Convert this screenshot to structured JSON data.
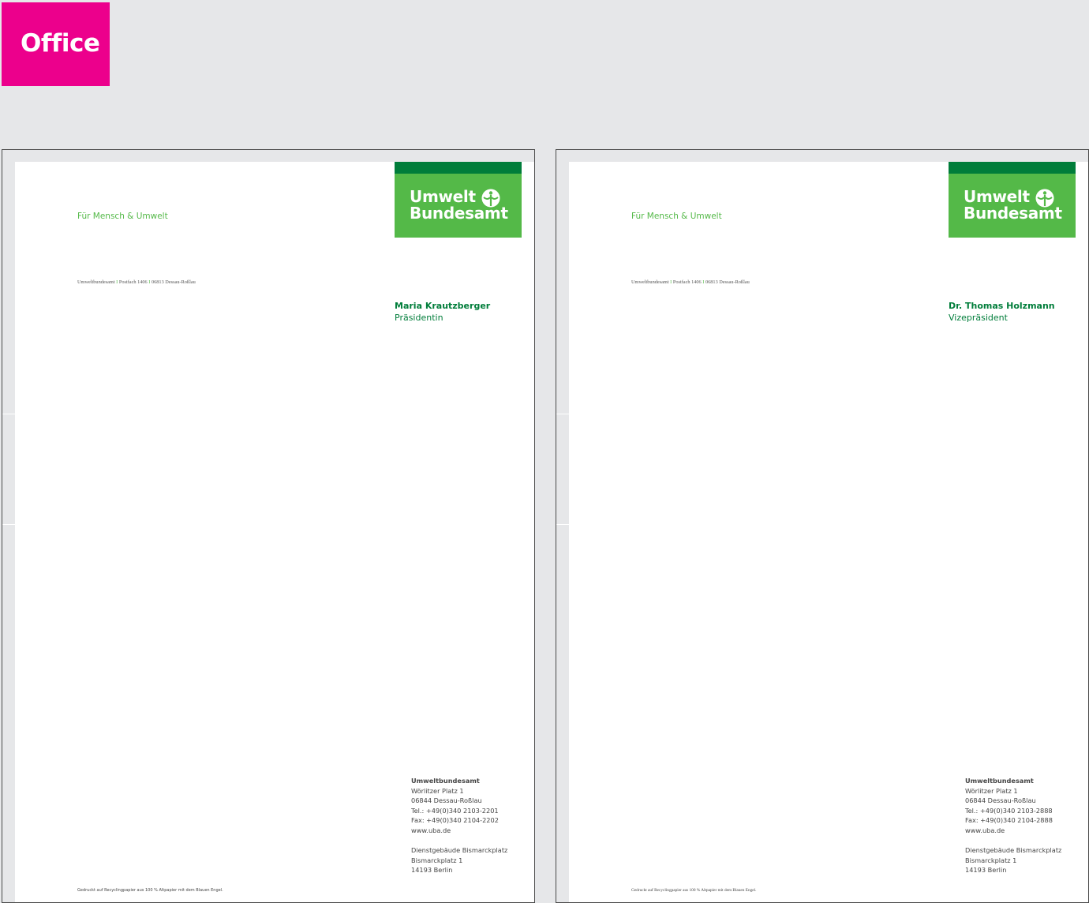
{
  "section_label": "Office",
  "colors": {
    "magenta": "#ec008c",
    "green": "#54b948",
    "dark_green": "#007d3a",
    "background": "#e6e7e9"
  },
  "logo": {
    "line1": "Umwelt",
    "line2": "Bundesamt",
    "emblem_icon": "uba-emblem-icon"
  },
  "motto": "Für Mensch & Umwelt",
  "sender_line": {
    "part1": "Umweltbundesamt",
    "sep": "I",
    "part2": "Postfach 1406",
    "part3": "06813 Dessau-Roßlau"
  },
  "letters": [
    {
      "person_name": "Maria Krautzberger",
      "person_role": "Präsidentin",
      "address": {
        "org": "Umweltbundesamt",
        "street": "Wörlitzer Platz 1",
        "city": "06844 Dessau-Roßlau",
        "tel": "Tel.: +49(0)340 2103-2201",
        "fax": "Fax: +49(0)340 2104-2202",
        "web": "www.uba.de",
        "building": "Dienstgebäude Bismarckplatz",
        "street2": "Bismarckplatz 1",
        "city2": "14193 Berlin"
      },
      "footnote": "Gedruckt auf Recyclingpapier aus 100 % Altpapier mit dem Blauen Engel."
    },
    {
      "person_name": "Dr. Thomas Holzmann",
      "person_role": "Vizepräsident",
      "address": {
        "org": "Umweltbundesamt",
        "street": "Wörlitzer Platz 1",
        "city": "06844 Dessau-Roßlau",
        "tel": "Tel.: +49(0)340 2103-2888",
        "fax": "Fax: +49(0)340 2104-2888",
        "web": "www.uba.de",
        "building": "Dienstgebäude Bismarckplatz",
        "street2": "Bismarckplatz 1",
        "city2": "14193 Berlin"
      },
      "footnote": "Gedruckt auf Recyclingpapier aus 100 % Altpapier mit dem Blauen Engel."
    }
  ]
}
